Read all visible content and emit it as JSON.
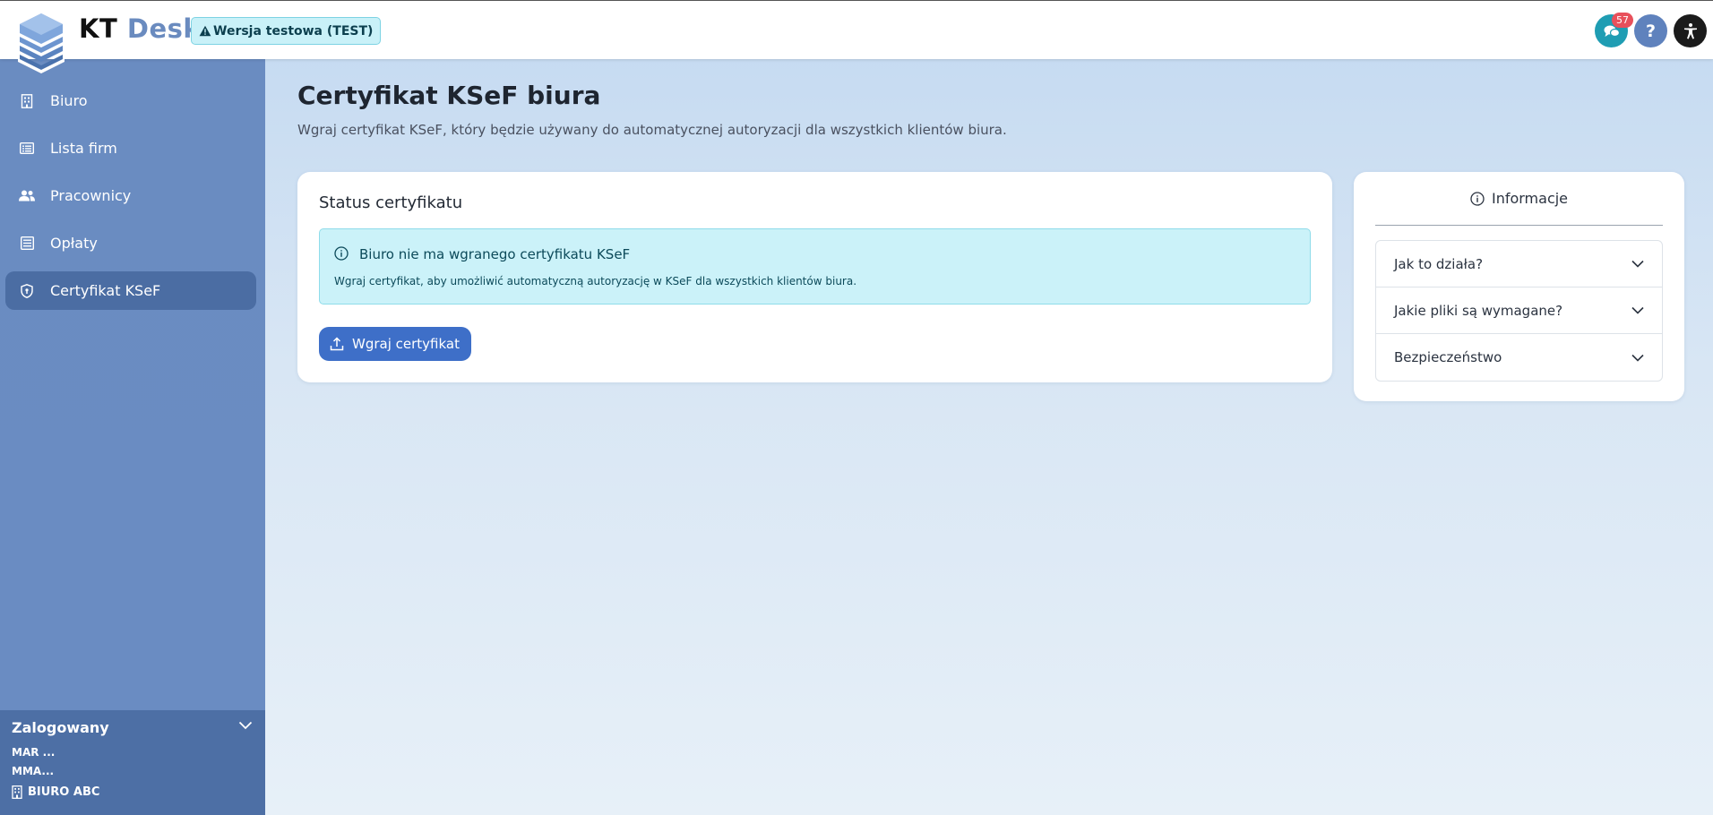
{
  "app": {
    "brand_kt": "KT",
    "brand_desk": "Desk",
    "test_badge": "Wersja testowa (TEST)"
  },
  "topbar": {
    "notification_count": "57",
    "help_label": "?"
  },
  "sidebar": {
    "items": [
      {
        "label": "Biuro",
        "icon": "building-icon",
        "active": false
      },
      {
        "label": "Lista firm",
        "icon": "list-icon",
        "active": false
      },
      {
        "label": "Pracownicy",
        "icon": "users-icon",
        "active": false
      },
      {
        "label": "Opłaty",
        "icon": "receipt-icon",
        "active": false
      },
      {
        "label": "Certyfikat KSeF",
        "icon": "shield-icon",
        "active": true
      }
    ],
    "footer": {
      "logged_label": "Zalogowany",
      "user_line1": "MAR ...",
      "user_line2": "MMA...",
      "organization": "BIURO ABC"
    }
  },
  "main": {
    "title": "Certyfikat KSeF biura",
    "subtitle": "Wgraj certyfikat KSeF, który będzie używany do automatycznej autoryzacji dla wszystkich klientów biura.",
    "status_card": {
      "title": "Status certyfikatu",
      "alert_heading": "Biuro nie ma wgranego certyfikatu KSeF",
      "alert_body": "Wgraj certyfikat, aby umożliwić automatyczną autoryzację w KSeF dla wszystkich klientów biura.",
      "upload_button": "Wgraj certyfikat"
    },
    "info_card": {
      "title": "Informacje",
      "accordion": [
        "Jak to działa?",
        "Jakie pliki są wymagane?",
        "Bezpieczeństwo"
      ]
    }
  },
  "colors": {
    "accent": "#3e6fc8",
    "sidebar": "#6a8cc1",
    "sidebar_active": "#4b6da3",
    "alert_bg": "#cbf2f9",
    "notification": "#e8505b"
  }
}
